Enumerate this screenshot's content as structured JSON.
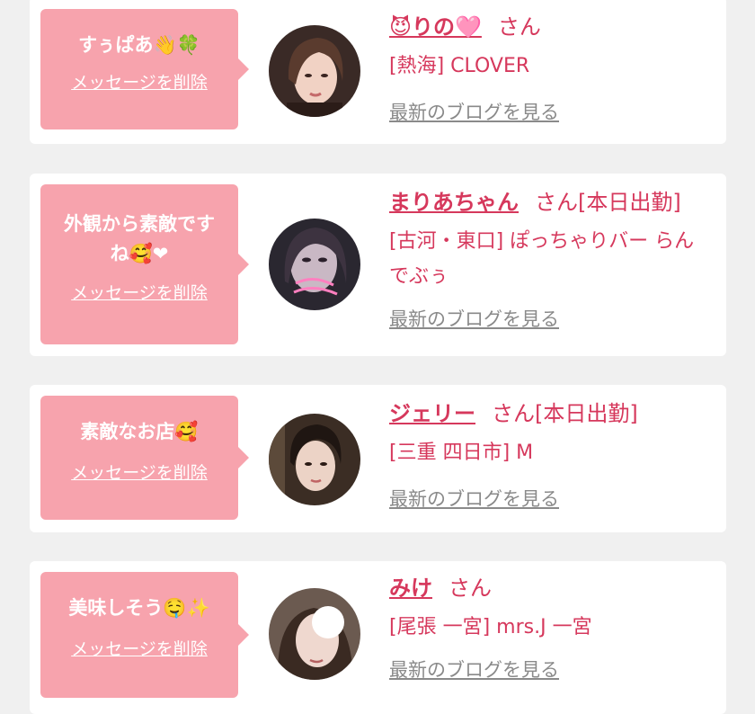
{
  "colors": {
    "background": "#f0f0f0",
    "card": "#ffffff",
    "bubble": "#f7a3ad",
    "accent": "#d6385c",
    "link_gray": "#8a8a8a"
  },
  "entries": [
    {
      "message": "すぅぱあ👋🍀",
      "delete_label": "メッセージを削除",
      "name": "😈りの🩷",
      "honorific": "さん",
      "status": "",
      "shop": "[熱海] CLOVER",
      "blog_label": "最新のブログを見る"
    },
    {
      "message": "外観から素敵です\nね🥰❤",
      "delete_label": "メッセージを削除",
      "name": "まりあちゃん",
      "honorific": "さん",
      "status": "[本日出勤]",
      "shop": "[古河・東口] ぽっちゃりバー らんでぶぅ",
      "blog_label": "最新のブログを見る"
    },
    {
      "message": "素敵なお店🥰",
      "delete_label": "メッセージを削除",
      "name": "ジェリー",
      "honorific": "さん",
      "status": "[本日出勤]",
      "shop": "[三重 四日市] M",
      "blog_label": "最新のブログを見る"
    },
    {
      "message": "美味しそう🤤✨",
      "delete_label": "メッセージを削除",
      "name": "みけ",
      "honorific": "さん",
      "status": "",
      "shop": "[尾張 一宮] mrs.J 一宮",
      "blog_label": "最新のブログを見る"
    }
  ]
}
